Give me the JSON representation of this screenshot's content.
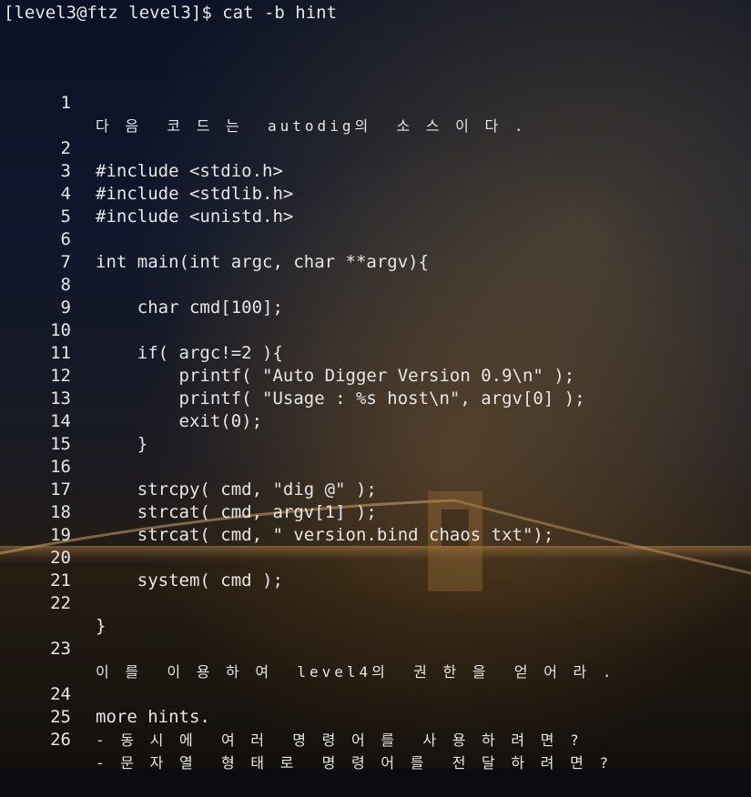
{
  "terminal": {
    "prompt_line": "[level3@ftz level3]$ cat -b hint",
    "lines": [
      {
        "num": "1",
        "text": "다 음  코 드 는  autodig의  소 스 이 다 ."
      },
      {
        "num": "2",
        "text": "#include <stdio.h>"
      },
      {
        "num": "3",
        "text": "#include <stdlib.h>"
      },
      {
        "num": "4",
        "text": "#include <unistd.h>"
      },
      {
        "num": "5",
        "text": ""
      },
      {
        "num": "6",
        "text": "int main(int argc, char **argv){"
      },
      {
        "num": "7",
        "text": ""
      },
      {
        "num": "8",
        "text": "    char cmd[100];"
      },
      {
        "num": "9",
        "text": ""
      },
      {
        "num": "10",
        "text": "    if( argc!=2 ){"
      },
      {
        "num": "11",
        "text": "        printf( \"Auto Digger Version 0.9\\n\" );"
      },
      {
        "num": "12",
        "text": "        printf( \"Usage : %s host\\n\", argv[0] );"
      },
      {
        "num": "13",
        "text": "        exit(0);"
      },
      {
        "num": "14",
        "text": "    }"
      },
      {
        "num": "15",
        "text": ""
      },
      {
        "num": "16",
        "text": "    strcpy( cmd, \"dig @\" );"
      },
      {
        "num": "17",
        "text": "    strcat( cmd, argv[1] );"
      },
      {
        "num": "18",
        "text": "    strcat( cmd, \" version.bind chaos txt\");"
      },
      {
        "num": "19",
        "text": ""
      },
      {
        "num": "20",
        "text": "    system( cmd );"
      },
      {
        "num": "21",
        "text": ""
      },
      {
        "num": "22",
        "text": "}"
      },
      {
        "num": "23",
        "text": "이 를  이 용 하 여  level4의  권 한 을  얻 어 라 ."
      },
      {
        "num": "24",
        "text": "more hints."
      },
      {
        "num": "25",
        "text": "- 동 시 에  여 러  명 령 어 를  사 용 하 려 면 ?"
      },
      {
        "num": "26",
        "text": "- 문 자 열  형 태 로  명 령 어 를  전 달 하 려 면 ?"
      }
    ]
  }
}
